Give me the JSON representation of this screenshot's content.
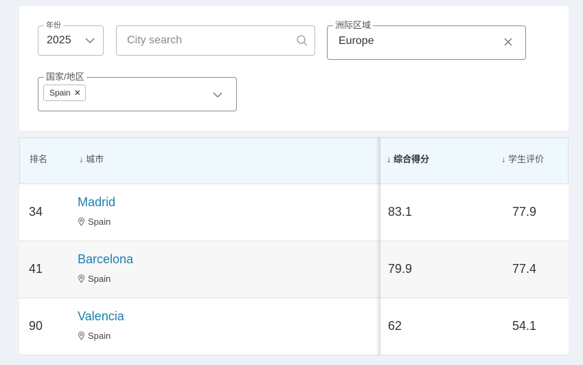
{
  "filters": {
    "year": {
      "label": "年份",
      "value": "2025"
    },
    "search": {
      "placeholder": "City search"
    },
    "region": {
      "label": "洲际区域",
      "value": "Europe"
    },
    "country": {
      "label": "国家/地区",
      "chip": "Spain"
    }
  },
  "table": {
    "headers": {
      "rank": "排名",
      "city": "↓ 城市",
      "score": "↓ 综合得分",
      "student": "↓ 学生评价"
    },
    "rows": [
      {
        "rank": "34",
        "city": "Madrid",
        "country": "Spain",
        "score": "83.1",
        "student": "77.9"
      },
      {
        "rank": "41",
        "city": "Barcelona",
        "country": "Spain",
        "score": "79.9",
        "student": "77.4"
      },
      {
        "rank": "90",
        "city": "Valencia",
        "country": "Spain",
        "score": "62",
        "student": "54.1"
      }
    ]
  },
  "colors": {
    "link": "#1a7fb0",
    "header_bg": "#eef8fd"
  }
}
